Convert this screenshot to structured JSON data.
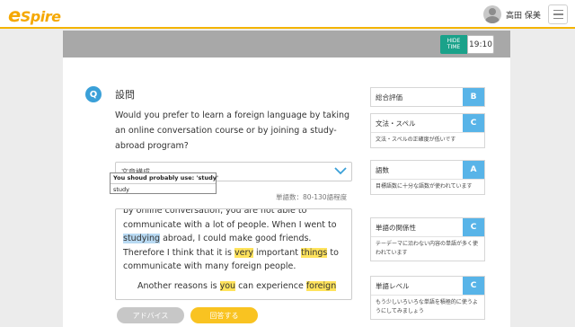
{
  "header": {
    "logo": "Spire",
    "user_name": "高田 保美"
  },
  "toolbar": {
    "hide_time_line1": "HIDE",
    "hide_time_line2": "TIME",
    "timer": "19:10"
  },
  "question": {
    "badge": "Q",
    "title": "設問",
    "text": "Would you prefer to learn a foreign language by taking an online conversation course or by joining a study-abroad program?"
  },
  "dropdown": {
    "value": "文章構成"
  },
  "tooltip": {
    "message": "You shoud probably use: 'study'",
    "suggestion": "study"
  },
  "word_count": "単語数：80-130語程度",
  "essay": {
    "line0": "by online conversation, you are not able to",
    "p1_a": "communicate with a lot of people. When I went to ",
    "p1_studying": "studying",
    "p1_b": " abroad, I could make good friends. Therefore I think that it is ",
    "p1_very": "very",
    "p1_c": " important ",
    "p1_things": "things",
    "p1_d": " to communicate with many foreign people.",
    "p2_a": "Another reasons is ",
    "p2_you": "you",
    "p2_b": " can experience ",
    "p2_foreign": "foreign"
  },
  "buttons": {
    "advice": "アドバイス",
    "answer": "回答する"
  },
  "panels": [
    {
      "title": "総合評価",
      "grade": "B",
      "desc": ""
    },
    {
      "title": "文法・スペル",
      "grade": "C",
      "desc": "文法・スペルの正確度が低いです"
    },
    {
      "title": "語数",
      "grade": "A",
      "desc": "目標語数に十分な語数が使われています"
    },
    {
      "title": "単語の関係性",
      "grade": "C",
      "desc": "テーデーマに沿わない内容の単語が多く使われています"
    },
    {
      "title": "単語レベル",
      "grade": "C",
      "desc": "もう少しいろいろな単語を積極的に使うようにしてみましょう"
    }
  ],
  "colors": {
    "brand": "#f5a800",
    "grade_badge": "#58b4e8",
    "hide_button": "#1aa28a",
    "answer_button": "#f9c321",
    "highlight_yellow": "#ffe35c",
    "highlight_blue": "#b8d9f2"
  }
}
